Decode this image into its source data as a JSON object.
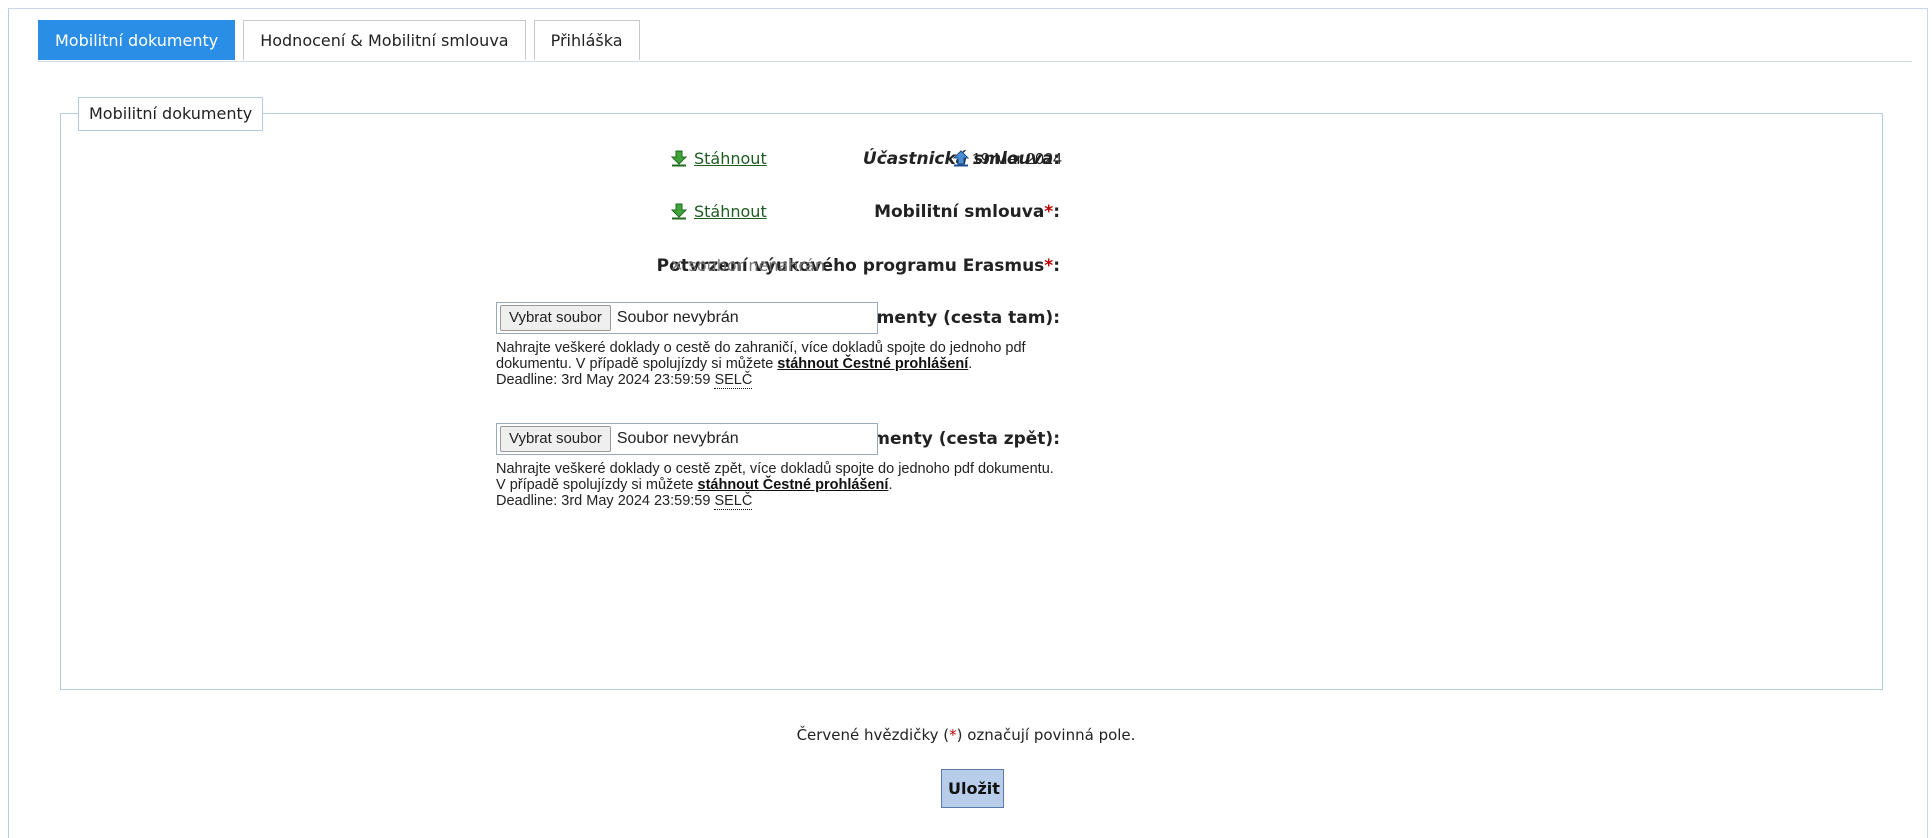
{
  "tabs": [
    {
      "label": "Mobilitní dokumenty",
      "active": true
    },
    {
      "label": "Hodnocení & Mobilitní smlouva",
      "active": false
    },
    {
      "label": "Přihláška",
      "active": false
    }
  ],
  "fieldset": {
    "legend": "Mobilitní dokumenty"
  },
  "rows": {
    "participant": {
      "label": "Účastnická smlouva",
      "colon": ":",
      "link": "Stáhnout",
      "uploaded_date": "19 Mar 2024"
    },
    "mobility": {
      "label": "Mobilitní smlouva",
      "star": "*",
      "colon": ":",
      "link": "Stáhnout"
    },
    "erasmus": {
      "label": "Potvrzení výukového programu Erasmus",
      "star": "*",
      "colon": ":",
      "status": "✕ soubor nenahrán"
    },
    "travel_to": {
      "label": "Cestovní dokumenty (cesta tam):",
      "button": "Vybrat soubor",
      "file": "Soubor nevybrán",
      "help_text": "Nahrajte veškeré doklady o cestě do zahraničí, více dokladů spojte do jednoho pdf dokumentu. V případě spolujízdy si můžete ",
      "help_link": "stáhnout Čestné prohlášení",
      "help_end": ".",
      "deadline": "Deadline: 3rd May 2024 23:59:59",
      "tz": "SELČ"
    },
    "travel_back": {
      "label": "Cestovní dokumenty (cesta zpět):",
      "button": "Vybrat soubor",
      "file": "Soubor nevybrán",
      "help_text": "Nahrajte veškeré doklady o cestě zpět, více dokladů spojte do jednoho pdf dokumentu. V případě spolujízdy si můžete ",
      "help_link": "stáhnout Čestné prohlášení",
      "help_end": ".",
      "deadline": "Deadline: 3rd May 2024 23:59:59",
      "tz": "SELČ"
    }
  },
  "note": {
    "before": "Červené hvězdičky (",
    "star": "*",
    "after": ") označují povinná pole."
  },
  "save_label": "Uložit",
  "icons": {
    "download": "download-arrow-icon",
    "upload": "upload-arrow-icon"
  },
  "colors": {
    "tab_active": "#2b8ee6",
    "required": "#c00000",
    "save_bg": "#b8cde9"
  }
}
